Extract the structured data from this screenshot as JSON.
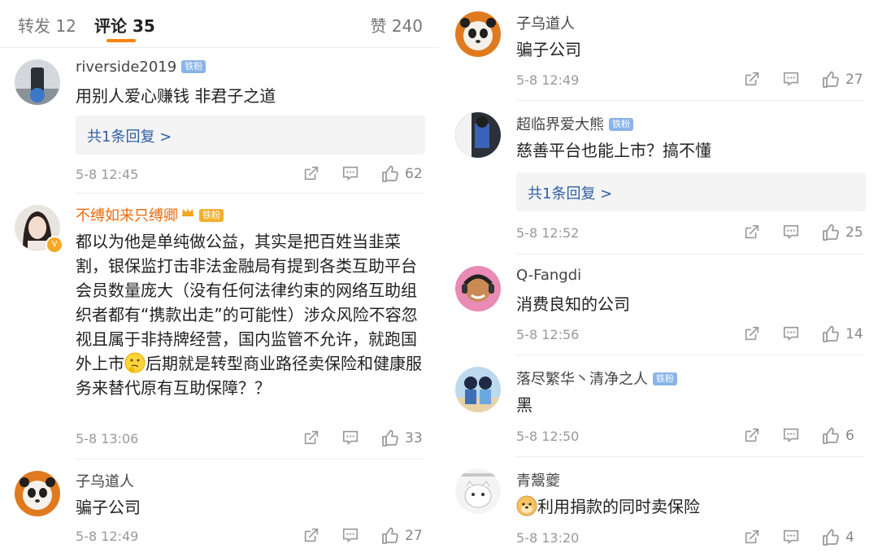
{
  "tabs": {
    "repost": "转发 12",
    "comments": "评论 35",
    "likes": "赞 240"
  },
  "colors": {
    "accent": "#ff8200",
    "link": "#2f5fa5",
    "vip_name": "#e86b0c",
    "meta": "#999999"
  },
  "icons": {
    "share": "share-icon",
    "comment": "comment-icon",
    "like": "thumbs-up-icon"
  },
  "left": [
    {
      "user": "riverside2019",
      "badge": "铁粉",
      "text": "用别人爱心赚钱 非君子之道",
      "reply": "共1条回复 >",
      "time": "5-8 12:45",
      "likes": "62"
    },
    {
      "user": "不缚如来只缚卿",
      "badge": "铁粉",
      "text": "都以为他是单纯做公益，其实是把百姓当韭菜割，银保监打击非法金融局有提到各类互助平台会员数量庞大（没有任何法律约束的网络互助组织者都有“携款出走”的可能性）涉众风险不容忽视且属于非持牌经营，国内监管不允许，就跑国外上市",
      "text_after": "后期就是转型商业路径卖保险和健康服务来替代原有互助保障？？",
      "time": "5-8 13:06",
      "likes": "33"
    },
    {
      "user": "子乌道人",
      "text": "骗子公司",
      "time": "5-8 12:49",
      "likes": "27"
    }
  ],
  "right": [
    {
      "user": "子乌道人",
      "text": "骗子公司",
      "time": "5-8 12:49",
      "likes": "27"
    },
    {
      "user": "超临界爱大熊",
      "badge": "铁粉",
      "text": "慈善平台也能上市？搞不懂",
      "reply": "共1条回复 >",
      "time": "5-8 12:52",
      "likes": "25"
    },
    {
      "user": "Q-Fangdi",
      "text": "消费良知的公司",
      "time": "5-8 12:56",
      "likes": "14"
    },
    {
      "user": "落尽繁华丶清净之人",
      "badge": "铁粉",
      "text": "黑",
      "time": "5-8 12:50",
      "likes": "6"
    },
    {
      "user": "青鬶夔",
      "text": "利用捐款的同时卖保险",
      "time": "5-8 13:20",
      "likes": "4"
    }
  ]
}
